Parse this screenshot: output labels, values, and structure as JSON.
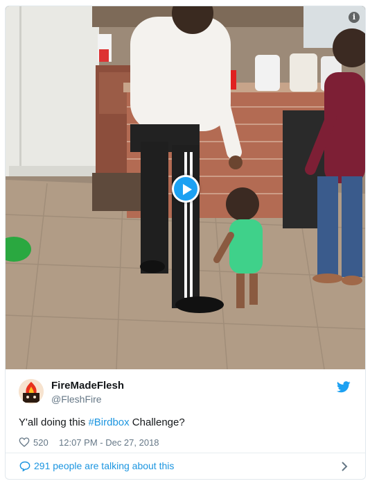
{
  "tweet": {
    "display_name": "FireMadeFlesh",
    "handle": "@FleshFire",
    "text_before": "Y'all doing this ",
    "hashtag": "#Birdbox",
    "text_after": " Challenge?",
    "likes": "520",
    "timestamp": "12:07 PM - Dec 27, 2018"
  },
  "footer": {
    "talking_label": "291 people are talking about this"
  },
  "video": {
    "play_icon": "play-icon",
    "info_icon": "info-icon",
    "info_glyph": "i"
  },
  "colors": {
    "accent": "#1da1f2",
    "link": "#1b95e0",
    "text": "#14171a",
    "muted": "#657786",
    "border": "#e1e8ed"
  }
}
